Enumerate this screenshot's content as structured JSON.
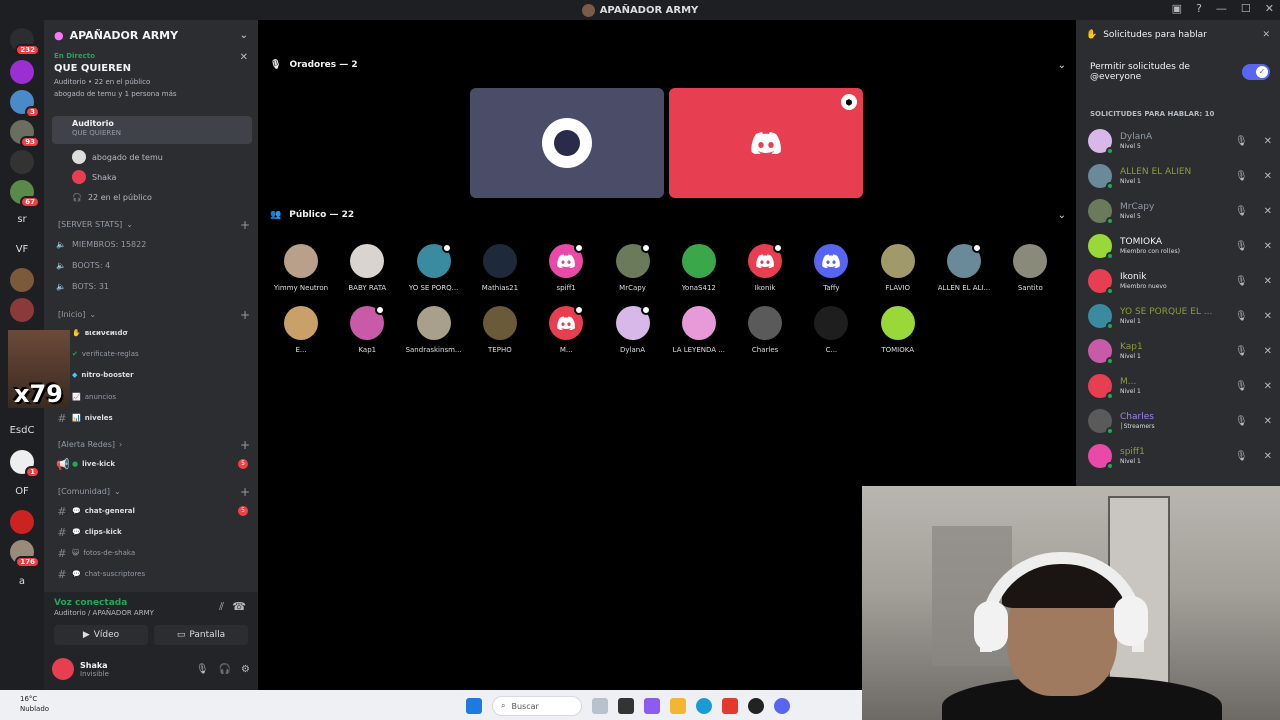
{
  "window": {
    "title": "APAÑADOR ARMY"
  },
  "rail": {
    "badges": [
      "232",
      "3",
      "93",
      "67",
      "1",
      "176"
    ],
    "texts": [
      "sr",
      "VF",
      "EsdC",
      "OF",
      "a"
    ]
  },
  "sidebar": {
    "guild_name": "APAÑADOR ARMY",
    "live_tag": "En Directo",
    "live_title": "QUE QUIEREN",
    "live_meta1": "Auditorio • 22 en el público",
    "live_meta2": "abogado de temu y 1 persona más",
    "active_channel": "Auditorio",
    "active_sub": "QUE QUIEREN",
    "voice_users": [
      "abogado de temu",
      "Shaka",
      "22 en el público"
    ],
    "cat_server_stats": "[SERVER STATS]",
    "stats": [
      "MIEMBROS: 15822",
      "BOOTS: 4",
      "BOTS: 31"
    ],
    "cat_inicio": "[Inicio]",
    "channels_inicio": [
      "вιєиνєиιdσ",
      "verificate-reglas",
      "nitro-booster",
      "anuncios",
      "niveles"
    ],
    "cat_alerta": "[Alerta Redes]",
    "live_kick": "live-kick",
    "live_kick_badge": "5",
    "cat_comunidad": "[Comunidad]",
    "channels_comunidad": [
      "chat-general",
      "clips-kick",
      "fotos-de-shaka",
      "chat-suscriptores"
    ],
    "chat_general_badge": "5",
    "emote_text": "x79"
  },
  "voice_panel": {
    "status": "Voz conectada",
    "location": "Auditorio / APAÑADOR ARMY",
    "video_label": "Vídeo",
    "screen_label": "Pantalla"
  },
  "user_panel": {
    "name": "Shaka",
    "status": "Invisible"
  },
  "stage": {
    "speakers_label": "Oradores — 2",
    "audience_label": "Público — 22",
    "audience": [
      "Yimmy Neutron",
      "BABY RATA",
      "YO SE PORQ...",
      "Mathias21",
      "spiff1",
      "MrCapy",
      "YonaS412",
      "Ikonik",
      "Taffy",
      "FLAVIO",
      "ALLEN EL ALI...",
      "Santito",
      "E...",
      "Kap1",
      "Sandraskinsm...",
      "TEPHO",
      "M...",
      "DylanA",
      "LA LEYENDA ...",
      "Charles",
      "C...",
      "TOMIOKA"
    ]
  },
  "requests": {
    "header": "Solicitudes para hablar",
    "toggle_label": "Permitir solicitudes de @everyone",
    "sub_label": "SOLICITUDES PARA HABLAR: 10",
    "items": [
      {
        "name": "DylanA",
        "level": "Nivel 5",
        "color": "#949ba4"
      },
      {
        "name": "ALLEN EL ALIEN",
        "level": "Nivel 1",
        "color": "#8f9a3a"
      },
      {
        "name": "MrCapy",
        "level": "Nivel 5",
        "color": "#949ba4"
      },
      {
        "name": "TOMIOKA",
        "level": "Miembro con rol(es)",
        "color": "#f2f3f5"
      },
      {
        "name": "Ikonik",
        "level": "Miembro nuevo",
        "color": "#f2f3f5"
      },
      {
        "name": "YO SE PORQUE EL ...",
        "level": "Nivel 1",
        "color": "#8f9a3a"
      },
      {
        "name": "Kap1",
        "level": "Nivel 1",
        "color": "#8f9a3a"
      },
      {
        "name": "M...",
        "level": "Nivel 1",
        "color": "#8f9a3a"
      },
      {
        "name": "Charles",
        "level": "│Streamers",
        "color": "#9b84ec"
      },
      {
        "name": "spiff1",
        "level": "Nivel 1",
        "color": "#8f9a3a"
      }
    ]
  },
  "taskbar": {
    "temp": "16°C",
    "weather": "Nublado",
    "search_placeholder": "Buscar"
  }
}
